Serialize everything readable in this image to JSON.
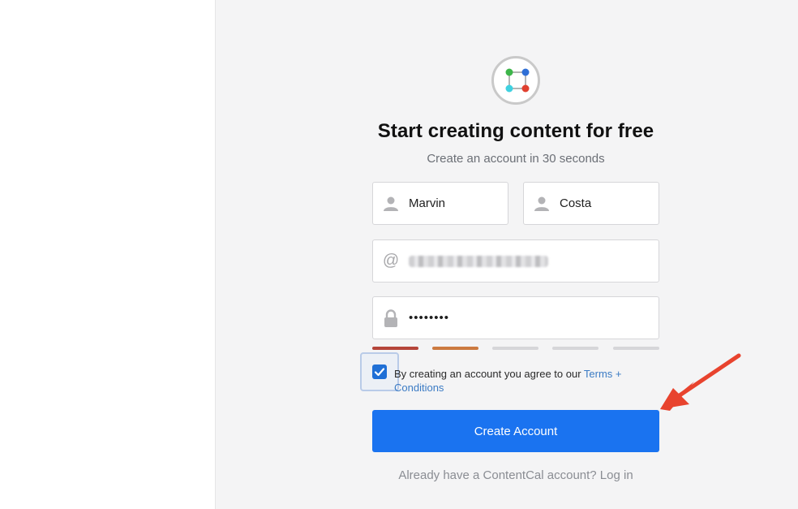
{
  "brand": {
    "logo_icon": "contentcal-logo-icon"
  },
  "form": {
    "title": "Start creating content for free",
    "subtitle": "Create an account in 30 seconds",
    "first_name": "Marvin",
    "last_name": "Costa",
    "email_icon": "@",
    "password_mask": "••••••••",
    "strength_colors": [
      "#b5453a",
      "#cc7a40",
      "#d6d6d9",
      "#d6d6d9",
      "#d6d6d9"
    ],
    "terms_checked": true,
    "terms_text": "By creating an account you agree to our ",
    "terms_link": "Terms + Conditions",
    "submit_label": "Create Account",
    "login_text": "Already have a ContentCal account? Log in"
  },
  "colors": {
    "accent": "#1a73f0",
    "arrow": "#e8432e"
  }
}
